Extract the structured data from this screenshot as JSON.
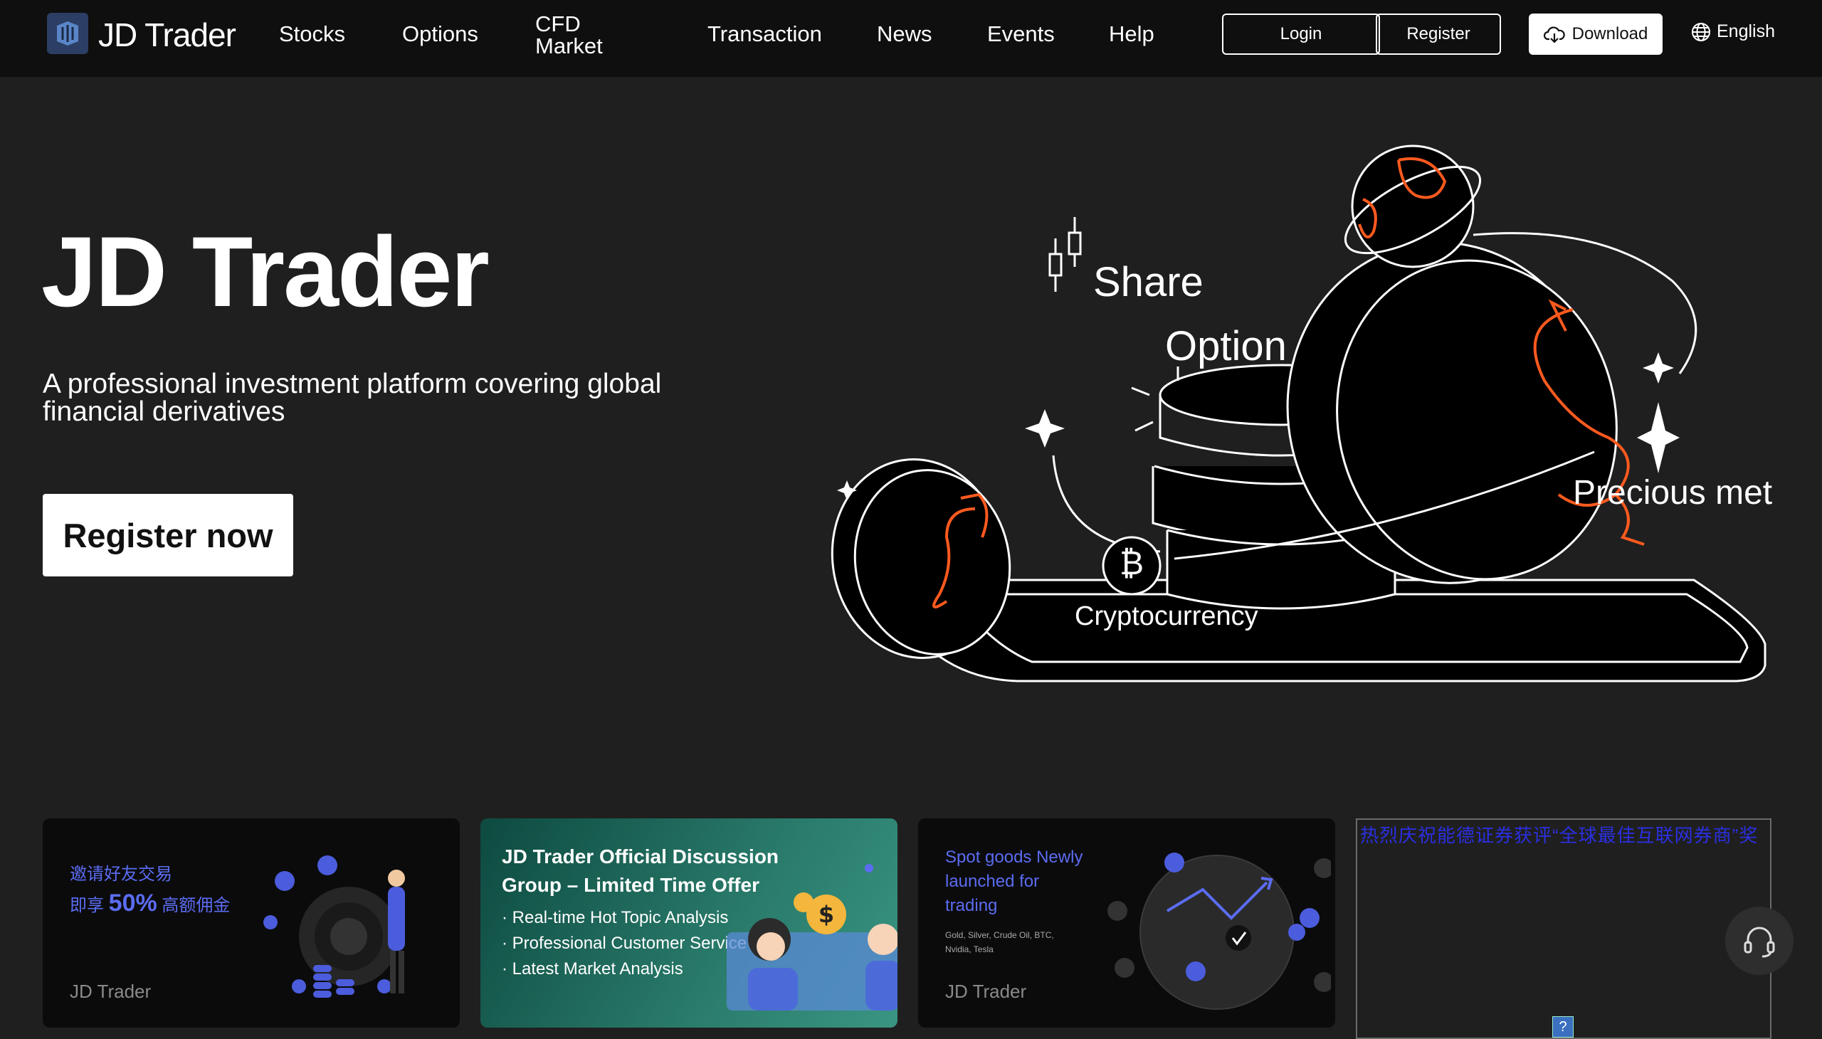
{
  "nav": {
    "brand": "JD Trader",
    "items": [
      "Stocks",
      "Options",
      "CFD Market",
      "Transaction",
      "News",
      "Events",
      "Help"
    ],
    "cfd_line1": "CFD",
    "cfd_line2": "Market",
    "login": "Login",
    "register": "Register",
    "download": "Download",
    "language": "English"
  },
  "hero": {
    "title": "JD Trader",
    "subtitle": "A professional investment platform covering global financial derivatives",
    "cta": "Register now",
    "labels": {
      "share": "Share",
      "option": "Option",
      "precious": "Precious met",
      "crypto": "Cryptocurrency"
    }
  },
  "cards": {
    "invite": {
      "line1": "邀请好友交易",
      "prefix": "即享 ",
      "percent": "50%",
      "suffix": " 高额佣金",
      "brand": "JD Trader"
    },
    "discussion": {
      "title": "JD Trader Official Discussion Group – Limited Time Offer",
      "bullets": [
        "· Real-time Hot Topic Analysis",
        "· Professional Customer Service Q&A",
        "· Latest Market Analysis"
      ]
    },
    "spot": {
      "title": "Spot goods Newly launched for trading",
      "assets": "Gold,   Silver,   Crude Oil, BTC,   Nvidia,   Tesla",
      "brand": "JD Trader"
    },
    "broken": {
      "link": "热烈庆祝能德证券获评“全球最佳互联网券商”奖",
      "qmark": "?"
    }
  },
  "colors": {
    "background": "#1f1f1f",
    "nav": "#0f0f0f",
    "accent_blue": "#5b6cf2",
    "accent_orange": "#ff5a1f"
  }
}
